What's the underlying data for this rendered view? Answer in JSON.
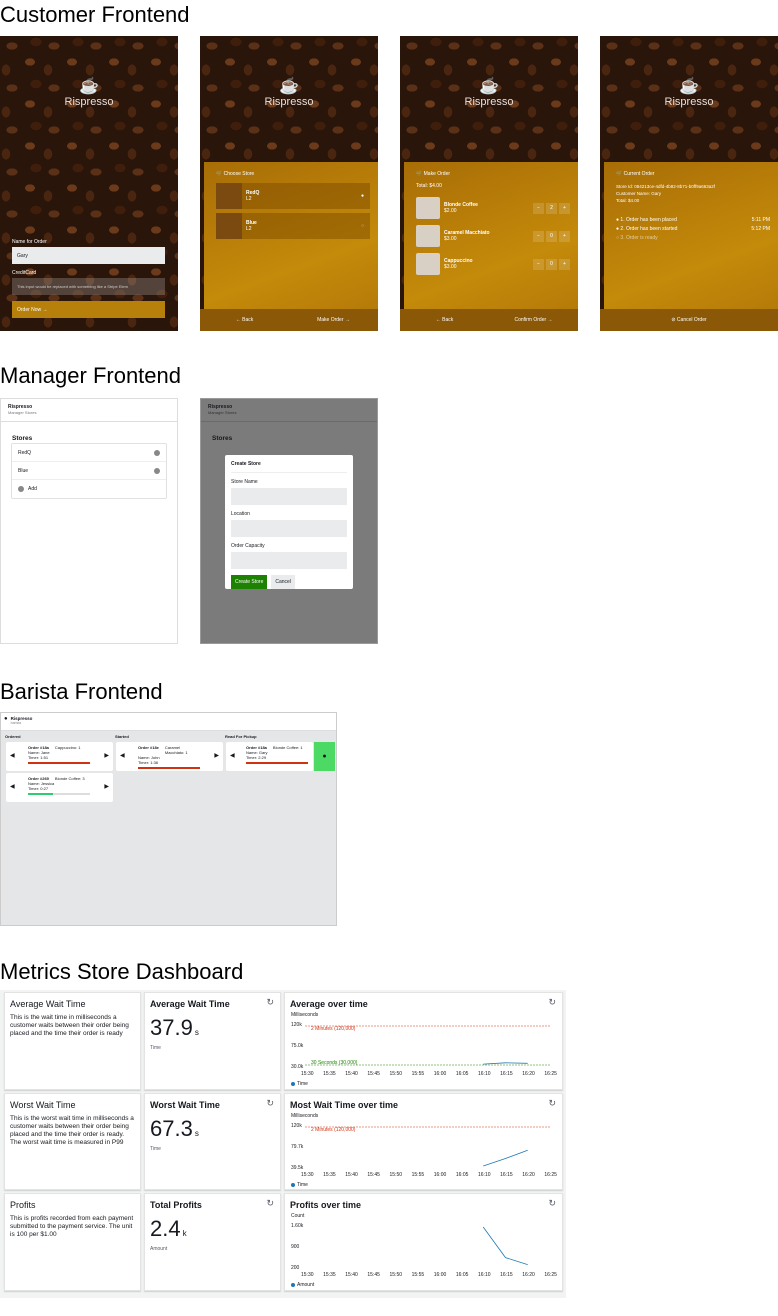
{
  "sections": {
    "customer": "Customer Frontend",
    "manager": "Manager Frontend",
    "barista": "Barista Frontend",
    "metrics": "Metrics Store Dashboard"
  },
  "customer": {
    "brand": "Rispresso",
    "screen1": {
      "name_label": "Name for Order",
      "name_value": "Gary",
      "cc_label": "CreditCard",
      "cc_placeholder": "This input would be replaced with something like a Stripe Elem",
      "order_now": "Order Now →"
    },
    "screen2": {
      "title": "Choose Store",
      "stores": [
        {
          "name": "RedQ",
          "loc": "L2"
        },
        {
          "name": "Blue",
          "loc": "L2"
        }
      ],
      "back": "← Back",
      "next": "Make Order →"
    },
    "screen3": {
      "title": "Make Order",
      "total": "Total: $4.00",
      "items": [
        {
          "name": "Blonde Coffee",
          "price": "$2.00",
          "qty": "2"
        },
        {
          "name": "Caramel Macchiato",
          "price": "$3.00",
          "qty": "0"
        },
        {
          "name": "Cappuccino",
          "price": "$3.00",
          "qty": "0"
        }
      ],
      "back": "← Back",
      "confirm": "Confirm Order →"
    },
    "screen4": {
      "title": "Current Order",
      "store_id": "Store Id: 084213ce-4dfd-4b82-8b71-b0ff9a663a2f",
      "customer": "Customer Name: Gary",
      "total": "Total: $4.00",
      "steps": [
        {
          "label": "1. Order has been placed",
          "time": "5:11 PM"
        },
        {
          "label": "2. Order has been started",
          "time": "5:12 PM"
        },
        {
          "label": "3. Order is ready",
          "time": ""
        }
      ],
      "cancel": "Cancel Order"
    }
  },
  "manager": {
    "brand": "Rispresso",
    "subtitle": "Manager Stores",
    "stores_title": "Stores",
    "stores": [
      "RedQ",
      "Blue"
    ],
    "add": "Add",
    "modal": {
      "title": "Create Store",
      "name_label": "Store Name",
      "location_label": "Location",
      "capacity_label": "Order Capacity",
      "create": "Create Store",
      "cancel": "Cancel"
    }
  },
  "barista": {
    "brand": "Rispresso",
    "subtitle": "barista",
    "columns": [
      "Ordered",
      "Started",
      "Read For Pickup"
    ],
    "orders": [
      {
        "order": "Order #18a",
        "item": "Cappuccino: 1",
        "name": "Name: Jane",
        "timer": "Timer: 1:51",
        "color": "#d13212"
      },
      {
        "order": "Order #269",
        "item": "Blonde Coffee: 3",
        "name": "Name: Jessica",
        "timer": "Timer: 0:27",
        "color": "#2ecc71"
      },
      {
        "order": "Order #18e",
        "item": "Caramel Macchiato: 1",
        "name": "Name: John",
        "timer": "Timer: 1:36",
        "color": "#d13212"
      },
      {
        "order": "Order #18a",
        "item": "Blonde Coffee: 1",
        "name": "Name: Gary",
        "timer": "Timer: 2:29",
        "color": "#d13212"
      }
    ]
  },
  "metrics": {
    "rows": [
      {
        "desc_title": "Average Wait Time",
        "desc": "This is the wait time in milliseconds a customer waits between their order being placed and the time their order is ready",
        "kpi_title": "Average Wait Time",
        "kpi_value": "37.9",
        "kpi_unit": "s",
        "kpi_sub": "Time",
        "chart_title": "Average over time",
        "ylabel": "Milliseconds",
        "yticks": [
          "120k",
          "75.0k",
          "30.0k"
        ],
        "thresholds": [
          "2 Minutes (120,000)",
          "30 Seconds (30,000)"
        ],
        "legend": "Time"
      },
      {
        "desc_title": "Worst Wait Time",
        "desc": "This is the worst wait time in milliseconds a customer waits between their order being placed and the time their order is ready. The worst wait time is measured in P99",
        "kpi_title": "Worst Wait Time",
        "kpi_value": "67.3",
        "kpi_unit": "s",
        "kpi_sub": "Time",
        "chart_title": "Most Wait Time over time",
        "ylabel": "Milliseconds",
        "yticks": [
          "120k",
          "79.7k",
          "39.5k"
        ],
        "thresholds": [
          "2 Minutes (120,000)"
        ],
        "legend": "Time"
      },
      {
        "desc_title": "Profits",
        "desc": "This is profits recorded from each payment submitted to the payment service. The unit is 100 per $1.00",
        "kpi_title": "Total Profits",
        "kpi_value": "2.4",
        "kpi_unit": "k",
        "kpi_sub": "Amount",
        "chart_title": "Profits over time",
        "ylabel": "Count",
        "yticks": [
          "1.60k",
          "900",
          "200"
        ],
        "thresholds": [],
        "legend": "Amount"
      }
    ],
    "xticks": [
      "15:30",
      "15:35",
      "15:40",
      "15:45",
      "15:50",
      "15:55",
      "16:00",
      "16:05",
      "16:10",
      "16:15",
      "16:20",
      "16:25"
    ]
  },
  "chart_data": [
    {
      "type": "line",
      "title": "Average over time",
      "ylabel": "Milliseconds",
      "series": [
        {
          "name": "Time",
          "x": [
            "16:10",
            "16:15",
            "16:20"
          ],
          "values": [
            32000,
            35000,
            34000
          ]
        }
      ],
      "ylim": [
        30000,
        120000
      ]
    },
    {
      "type": "line",
      "title": "Most Wait Time over time",
      "ylabel": "Milliseconds",
      "series": [
        {
          "name": "Time",
          "x": [
            "16:10",
            "16:15",
            "16:20"
          ],
          "values": [
            39500,
            55000,
            72000
          ]
        }
      ],
      "ylim": [
        39500,
        120000
      ]
    },
    {
      "type": "line",
      "title": "Profits over time",
      "ylabel": "Count",
      "series": [
        {
          "name": "Amount",
          "x": [
            "16:10",
            "16:15",
            "16:20"
          ],
          "values": [
            1600,
            500,
            250
          ]
        }
      ],
      "ylim": [
        200,
        1600
      ]
    }
  ]
}
